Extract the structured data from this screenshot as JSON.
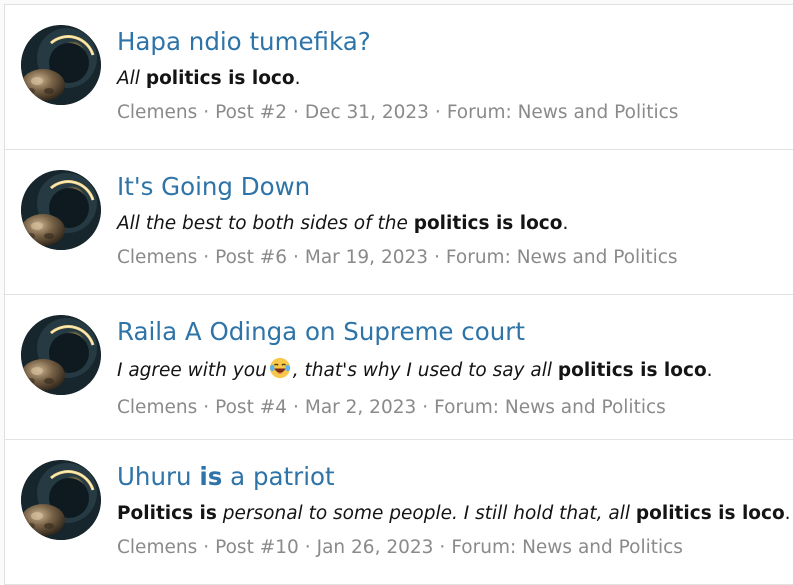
{
  "results": [
    {
      "title": "Hapa ndio tumefika?",
      "snippet": [
        "All",
        " ",
        "politics is loco",
        "."
      ],
      "author": "Clemens",
      "post": "Post #2",
      "date": "Dec 31, 2023",
      "forum": "Forum: News and Politics"
    },
    {
      "title": "It's Going Down",
      "snippet": [
        "All the best to both sides of the",
        " ",
        "politics is loco",
        "."
      ],
      "author": "Clemens",
      "post": "Post #6",
      "date": "Mar 19, 2023",
      "forum": "Forum: News and Politics"
    },
    {
      "title": "Raila A Odinga on Supreme court",
      "snippet": [
        "I agree with you",
        ", that's why I used to say all",
        " ",
        "politics is loco",
        "."
      ],
      "author": "Clemens",
      "post": "Post #4",
      "date": "Mar 2, 2023",
      "forum": "Forum: News and Politics"
    },
    {
      "title": [
        "Uhuru ",
        "is",
        " a patriot"
      ],
      "snippet": [
        "Politics is",
        " personal to some people. I still hold that, all ",
        "politics is loco",
        "."
      ],
      "author": "Clemens",
      "post": "Post #10",
      "date": "Jan 26, 2023",
      "forum": "Forum: News and Politics"
    }
  ],
  "meta_separator": "·",
  "colors": {
    "title_link": "#2e74a8",
    "meta_text": "#8a8a8a",
    "body_text": "#141414",
    "divider": "#e2e2e2"
  },
  "icons": {
    "avatar": "eclipse-avatar-image",
    "emoji": "laughing-emoji-icon"
  }
}
